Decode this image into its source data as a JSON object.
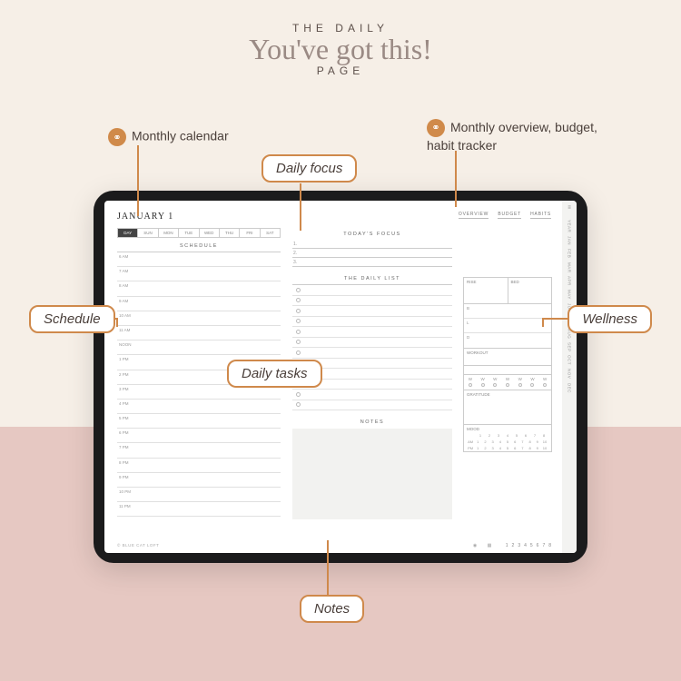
{
  "header": {
    "line1": "THE DAILY",
    "script": "You've got this!",
    "line3": "PAGE"
  },
  "callouts": {
    "monthly_calendar": "Monthly calendar",
    "monthly_overview": "Monthly overview, budget, habit tracker",
    "daily_focus": "Daily focus",
    "schedule": "Schedule",
    "daily_tasks": "Daily tasks",
    "wellness": "Wellness",
    "notes": "Notes"
  },
  "page": {
    "date": "JANUARY 1",
    "nav": {
      "overview": "OVERVIEW",
      "budget": "BUDGET",
      "habits": "HABITS"
    },
    "days": [
      "DAY",
      "SUN",
      "MON",
      "TUE",
      "WED",
      "THU",
      "FRI",
      "SAT"
    ],
    "schedule_title": "SCHEDULE",
    "times": [
      "6 AM",
      "7 AM",
      "8 AM",
      "9 AM",
      "10 AM",
      "11 AM",
      "NOON",
      "1 PM",
      "2 PM",
      "3 PM",
      "4 PM",
      "5 PM",
      "6 PM",
      "7 PM",
      "8 PM",
      "9 PM",
      "10 PM",
      "11 PM"
    ],
    "focus_title": "TODAY'S FOCUS",
    "focus_nums": [
      "1.",
      "2.",
      "3."
    ],
    "list_title": "THE DAILY LIST",
    "notes_title": "NOTES",
    "rise": "RISE",
    "bed": "BED",
    "meals": [
      "B",
      "L",
      "D"
    ],
    "workout": "WORKOUT",
    "wdays": [
      "W",
      "W",
      "W",
      "W",
      "W",
      "W",
      "W"
    ],
    "gratitude": "GRATITUDE",
    "mood": "MOOD",
    "mood_nums": [
      "1",
      "2",
      "3",
      "4",
      "5",
      "6",
      "7",
      "8"
    ],
    "mood_vals": [
      "AM",
      "1",
      "2",
      "3",
      "4",
      "5",
      "6",
      "7",
      "8",
      "9",
      "10"
    ],
    "mood_vals2": [
      "PM",
      "1",
      "2",
      "3",
      "4",
      "5",
      "6",
      "7",
      "8",
      "9",
      "10"
    ],
    "footer": "© BLUE CAT LOFT",
    "foot_pages": [
      "1",
      "2",
      "3",
      "4",
      "5",
      "6",
      "7",
      "8"
    ]
  },
  "tabs": [
    "YEAR",
    "JAN",
    "FEB",
    "MAR",
    "APR",
    "MAY",
    "JUN",
    "JUL",
    "AUG",
    "SEP",
    "OCT",
    "NOV",
    "DEC"
  ]
}
